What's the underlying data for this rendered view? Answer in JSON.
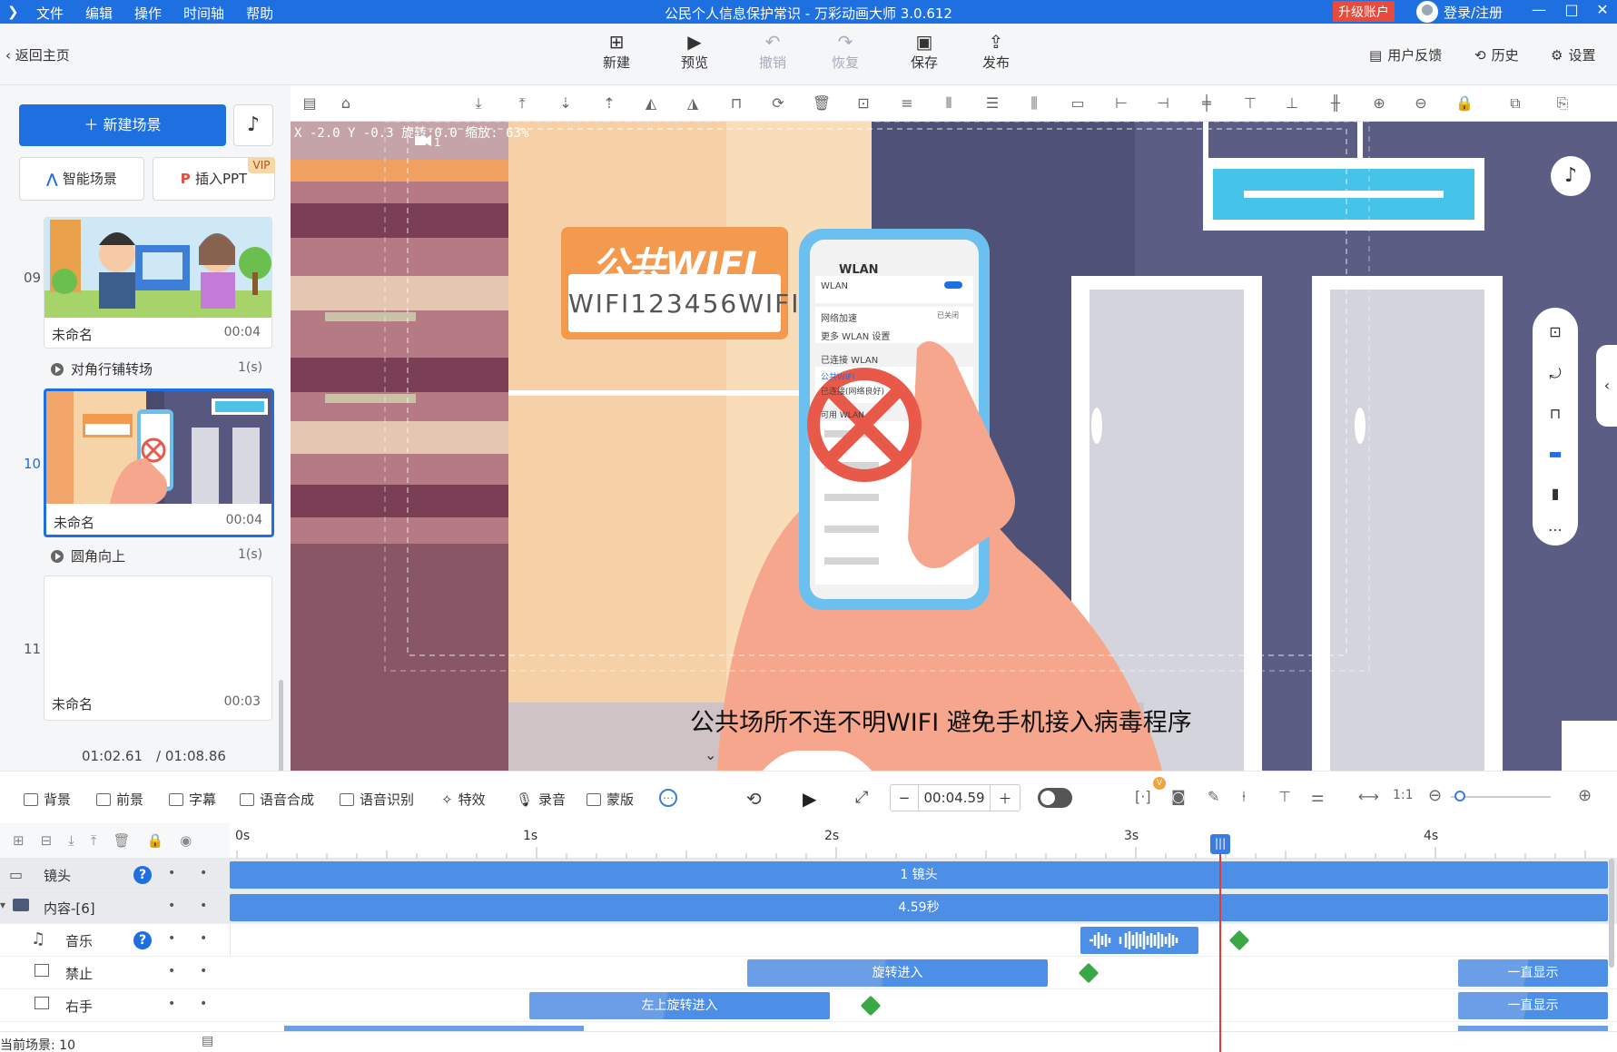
{
  "titlebar": {
    "menu": [
      "文件",
      "编辑",
      "操作",
      "时间轴",
      "帮助"
    ],
    "title": "公民个人信息保护常识 - 万彩动画大师 3.0.612",
    "upgrade": "升级账户",
    "login": "登录/注册"
  },
  "toolbar": {
    "back": "返回主页",
    "new": "新建",
    "preview": "预览",
    "undo": "撤销",
    "redo": "恢复",
    "save": "保存",
    "publish": "发布",
    "feedback": "用户反馈",
    "history": "历史",
    "settings": "设置"
  },
  "leftpanel": {
    "new_scene": "新建场景",
    "smart_scene": "智能场景",
    "insert_ppt": "插入PPT",
    "vip": "VIP",
    "scenes": [
      {
        "num": "09",
        "name": "未命名",
        "dur": "00:04"
      },
      {
        "num": "10",
        "name": "未命名",
        "dur": "00:04"
      },
      {
        "num": "11",
        "name": "未命名",
        "dur": "00:03"
      }
    ],
    "transitions": [
      {
        "name": "对角行铺转场",
        "dur": "1(s)"
      },
      {
        "name": "圆角向上",
        "dur": "1(s)"
      }
    ],
    "current_time": "01:02.61",
    "total_time": "/ 01:08.86"
  },
  "canvas": {
    "coords": "X -2.0 Y -0.3 旋转:0.0 缩放: 63%",
    "camera_label": "1",
    "sign_title": "公共WIFI",
    "sign_text": "WIFI123456WIFI",
    "phone": {
      "header": "WLAN",
      "wlan": "WLAN",
      "accel": "网络加速",
      "accel_val": "已关闭",
      "more": "更多 WLAN 设置",
      "connected": "已连接 WLAN",
      "public_wifi": "公共WIFI",
      "conn_status": "已连接(网络良好)",
      "available": "可用 WLAN"
    },
    "subtitle": "公共场所不连不明WIFI 避免手机接入病毒程序"
  },
  "tltoolbar": {
    "items": [
      "背景",
      "前景",
      "字幕",
      "语音合成",
      "语音识别",
      "特效",
      "录音",
      "蒙版"
    ],
    "time": "00:04.59"
  },
  "timeline": {
    "ticks": [
      "0s",
      "1s",
      "2s",
      "3s",
      "4s"
    ],
    "tracks": [
      {
        "name": "镜头",
        "bar": "1 镜头"
      },
      {
        "name": "内容-[6]",
        "bar": "4.59秒"
      },
      {
        "name": "音乐"
      },
      {
        "name": "禁止",
        "bar": "旋转进入",
        "end": "一直显示"
      },
      {
        "name": "右手",
        "bar": "左上旋转进入",
        "end": "一直显示"
      }
    ],
    "current_scene": "当前场景: 10"
  }
}
